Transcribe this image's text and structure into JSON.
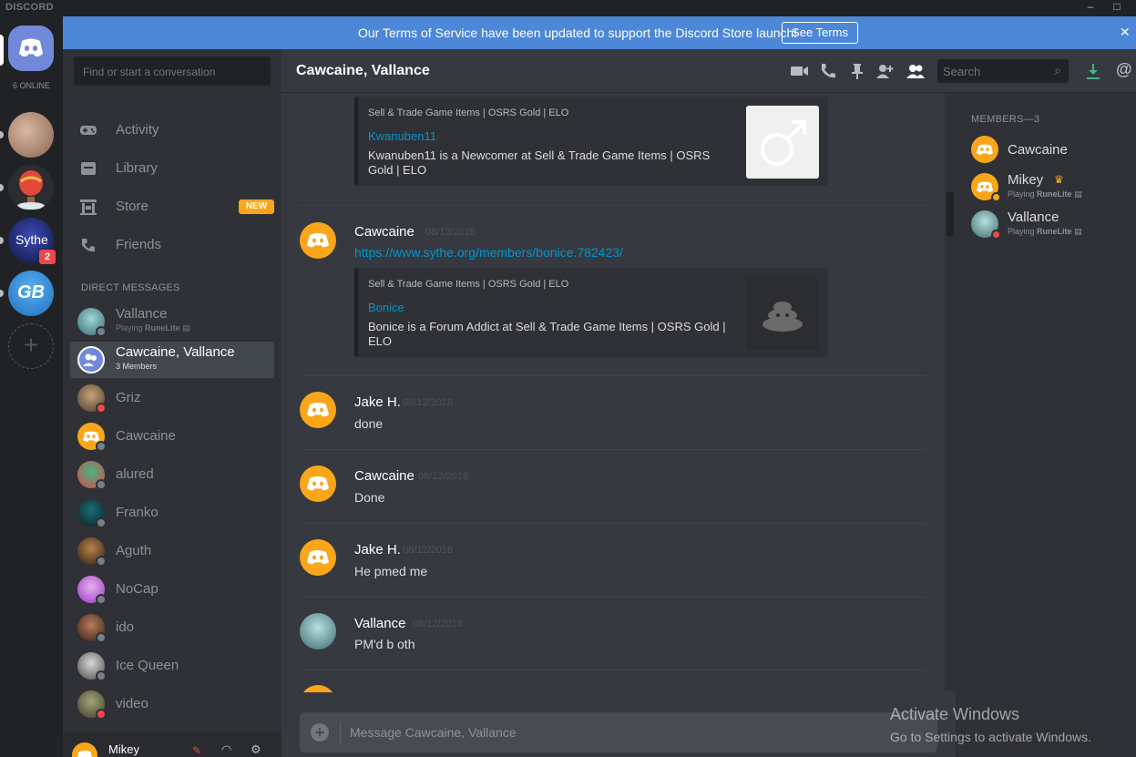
{
  "titlebar": {
    "brand": "DISCORD"
  },
  "guilds": {
    "online_count": "6 ONLINE",
    "items": [
      {
        "name": "home"
      },
      {
        "name": "server-1"
      },
      {
        "name": "server-2"
      },
      {
        "name": "Sythe",
        "label": "Sythe",
        "badge": "2"
      },
      {
        "name": "GB",
        "label": "GB"
      }
    ],
    "add_label": "+"
  },
  "banner": {
    "message": "Our Terms of Service have been updated to support the Discord Store launch!",
    "button": "See Terms"
  },
  "sidebar": {
    "search_placeholder": "Find or start a conversation",
    "nav": [
      {
        "label": "Activity",
        "icon": "gamepad-icon"
      },
      {
        "label": "Library",
        "icon": "library-icon"
      },
      {
        "label": "Store",
        "icon": "store-icon",
        "badge": "NEW"
      },
      {
        "label": "Friends",
        "icon": "friends-icon"
      }
    ],
    "dm_header": "DIRECT MESSAGES",
    "dms": [
      {
        "name": "Vallance",
        "sub_prefix": "Playing",
        "sub_game": "RuneLite",
        "status": "#747f8d"
      },
      {
        "name": "Cawcaine, Vallance",
        "sub": "3 Members",
        "active": true
      },
      {
        "name": "Griz",
        "status": "#f04747"
      },
      {
        "name": "Cawcaine",
        "status": "#747f8d"
      },
      {
        "name": "alured",
        "status": "#747f8d"
      },
      {
        "name": "Franko",
        "status": "#747f8d"
      },
      {
        "name": "Aguth",
        "status": "#747f8d"
      },
      {
        "name": "NoCap",
        "status": "#747f8d"
      },
      {
        "name": "ido",
        "status": "#747f8d"
      },
      {
        "name": "Ice Queen",
        "status": "#747f8d"
      },
      {
        "name": "video",
        "status": "#f04747"
      }
    ],
    "user": {
      "name": "Mikey"
    }
  },
  "chat": {
    "title": "Cawcaine, Vallance",
    "search_placeholder": "Search",
    "composer_placeholder": "Message Cawcaine, Vallance",
    "embed1": {
      "provider": "Sell & Trade Game Items | OSRS Gold | ELO",
      "title": "Kwanuben11",
      "description": "Kwanuben11 is a Newcomer at Sell & Trade Game Items | OSRS Gold | ELO"
    },
    "messages": [
      {
        "author": "Cawcaine",
        "time": "08/12/2018",
        "link": "https://www.sythe.org/members/bonice.782423/",
        "embed": {
          "provider": "Sell & Trade Game Items | OSRS Gold | ELO",
          "title": "Bonice",
          "description": "Bonice is a Forum Addict at Sell & Trade Game Items | OSRS Gold | ELO"
        }
      },
      {
        "author": "Jake H.",
        "time": "08/12/2018",
        "text": "done"
      },
      {
        "author": "Cawcaine",
        "time": "08/12/2018",
        "text": "Done"
      },
      {
        "author": "Jake H.",
        "time": "08/12/2018",
        "text": "He pmed me"
      },
      {
        "author": "Vallance",
        "time": "08/12/2018",
        "text": "PM'd b oth"
      }
    ]
  },
  "members": {
    "header": "MEMBERS—3",
    "list": [
      {
        "name": "Cawcaine"
      },
      {
        "name": "Mikey",
        "sub_prefix": "Playing",
        "sub_game": "RuneLite",
        "owner": true,
        "status": "#faa61a"
      },
      {
        "name": "Vallance",
        "sub_prefix": "Playing",
        "sub_game": "RuneLite",
        "status": "#f04747"
      }
    ]
  },
  "watermark": {
    "line1": "Activate Windows",
    "line2": "Go to Settings to activate Windows."
  },
  "colors": {
    "blurple": "#7289da",
    "orange": "#faa61a",
    "link": "#0096cf",
    "banner": "#4c87d8"
  }
}
